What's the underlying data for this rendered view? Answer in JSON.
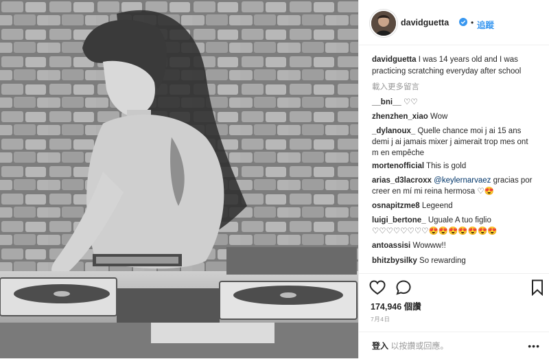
{
  "header": {
    "username": "davidguetta",
    "dot": "•",
    "follow_label": "追蹤"
  },
  "caption": {
    "username": "davidguetta",
    "text": "I was 14 years old and I was practicing scratching everyday after school"
  },
  "load_more": "載入更多留言",
  "comments": [
    {
      "user": "__bni__",
      "text": "♡♡"
    },
    {
      "user": "zhenzhen_xiao",
      "text": "Wow"
    },
    {
      "user": "_dylanoux_",
      "text": "Quelle chance moi j ai 15 ans demi j ai jamais mixer j aimerait trop mes ont m en empêche"
    },
    {
      "user": "mortenofficial",
      "text": "This is gold"
    },
    {
      "user": "arias_d3lacroxx",
      "mention": "@keylernarvaez",
      "text": "gracias por creer en mí mi reina hermosa ♡😍"
    },
    {
      "user": "osnapitzme8",
      "text": "Legeend"
    },
    {
      "user": "luigi_bertone_",
      "text": "Uguale A tuo figlio ♡♡♡♡♡♡♡♡😍😍😍😍😍😍😍"
    },
    {
      "user": "antoassisi",
      "text": "Wowww!!"
    },
    {
      "user": "bhitzbysilky",
      "text": "So rewarding"
    }
  ],
  "likes": "174,946 個讚",
  "date": "7月4日",
  "login_prompt": {
    "login": "登入",
    "rest": "以按讚或回應。"
  },
  "more_label": "•••",
  "icons": {
    "like": "heart-icon",
    "comment": "comment-icon",
    "save": "bookmark-icon",
    "verified": "verified-badge-icon"
  },
  "colors": {
    "accent": "#3897f0",
    "mention": "#003569",
    "muted": "#999999"
  }
}
